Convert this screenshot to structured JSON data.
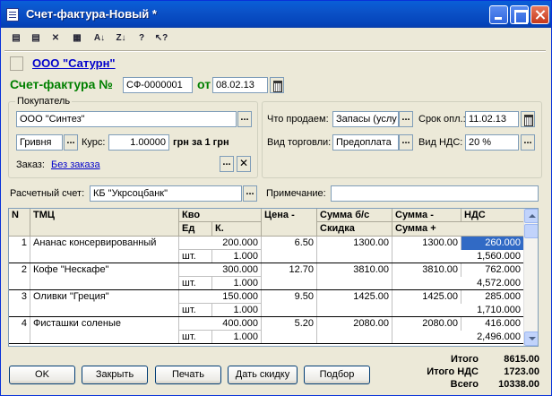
{
  "window": {
    "title": "Счет-фактура-Новый *"
  },
  "toolbar": [
    {
      "icon": "add-row-icon",
      "glyph": "▤"
    },
    {
      "icon": "copy-row-icon",
      "glyph": "▤"
    },
    {
      "icon": "delete-row-icon",
      "glyph": "✕"
    },
    {
      "icon": "edit-row-icon",
      "glyph": "▦"
    },
    {
      "icon": "sort-asc-icon",
      "glyph": "A↓"
    },
    {
      "icon": "sort-desc-icon",
      "glyph": "Z↓"
    },
    {
      "icon": "help-icon",
      "glyph": "?"
    },
    {
      "icon": "context-help-icon",
      "glyph": "↖?"
    }
  ],
  "header": {
    "organization": "ООО \"Сатурн\"",
    "doc_title": "Счет-фактура №",
    "doc_number": "СФ-0000001",
    "date_label": "от",
    "date": "08.02.13"
  },
  "buyer": {
    "group_label": "Покупатель",
    "name": "ООО \"Синтез\"",
    "currency": "Гривня",
    "rate_label": "Курс:",
    "rate": "1.00000",
    "rate_suffix": "грн за 1 грн",
    "order_label": "Заказ:",
    "order_value": "Без заказа"
  },
  "right": {
    "sell_label": "Что продаем:",
    "sell_value": "Запасы (услу",
    "due_label": "Срок опл.:",
    "due_value": "11.02.13",
    "trade_label": "Вид торговли:",
    "trade_value": "Предоплата",
    "vat_label": "Вид НДС:",
    "vat_value": "20 %"
  },
  "account": {
    "label": "Расчетный счет:",
    "value": "КБ \"Укрсоцбанк\"",
    "note_label": "Примечание:",
    "note_value": ""
  },
  "table": {
    "headers": {
      "n": "N",
      "item": "ТМЦ",
      "qty": "Кво",
      "unit": "Ед",
      "k": "К.",
      "price": "Цена -",
      "sum": "Сумма б/с",
      "discount": "Скидка",
      "sum_minus": "Сумма -",
      "sum_plus": "Сумма +",
      "vat": "НДС"
    },
    "rows": [
      {
        "n": "1",
        "item": "Ананас консервированный",
        "qty": "200.000",
        "unit": "шт.",
        "k": "1.000",
        "price": "6.50",
        "sum": "1300.00",
        "discount": "",
        "sum_minus": "1300.00",
        "vat": "260.000",
        "sum_plus": "1,560.000"
      },
      {
        "n": "2",
        "item": "Кофе \"Нескафе\"",
        "qty": "300.000",
        "unit": "шт.",
        "k": "1.000",
        "price": "12.70",
        "sum": "3810.00",
        "discount": "",
        "sum_minus": "3810.00",
        "vat": "762.000",
        "sum_plus": "4,572.000"
      },
      {
        "n": "3",
        "item": "Оливки \"Греция\"",
        "qty": "150.000",
        "unit": "шт.",
        "k": "1.000",
        "price": "9.50",
        "sum": "1425.00",
        "discount": "",
        "sum_minus": "1425.00",
        "vat": "285.000",
        "sum_plus": "1,710.000"
      },
      {
        "n": "4",
        "item": "Фисташки соленые",
        "qty": "400.000",
        "unit": "шт.",
        "k": "1.000",
        "price": "5.20",
        "sum": "2080.00",
        "discount": "",
        "sum_minus": "2080.00",
        "vat": "416.000",
        "sum_plus": "2,496.000"
      }
    ]
  },
  "buttons": {
    "ok": "OK",
    "close": "Закрыть",
    "print": "Печать",
    "discount": "Дать скидку",
    "select": "Подбор"
  },
  "totals": {
    "total_label": "Итого",
    "total_value": "8615.00",
    "vat_label": "Итого НДС",
    "vat_value": "1723.00",
    "grand_label": "Всего",
    "grand_value": "10338.00"
  }
}
